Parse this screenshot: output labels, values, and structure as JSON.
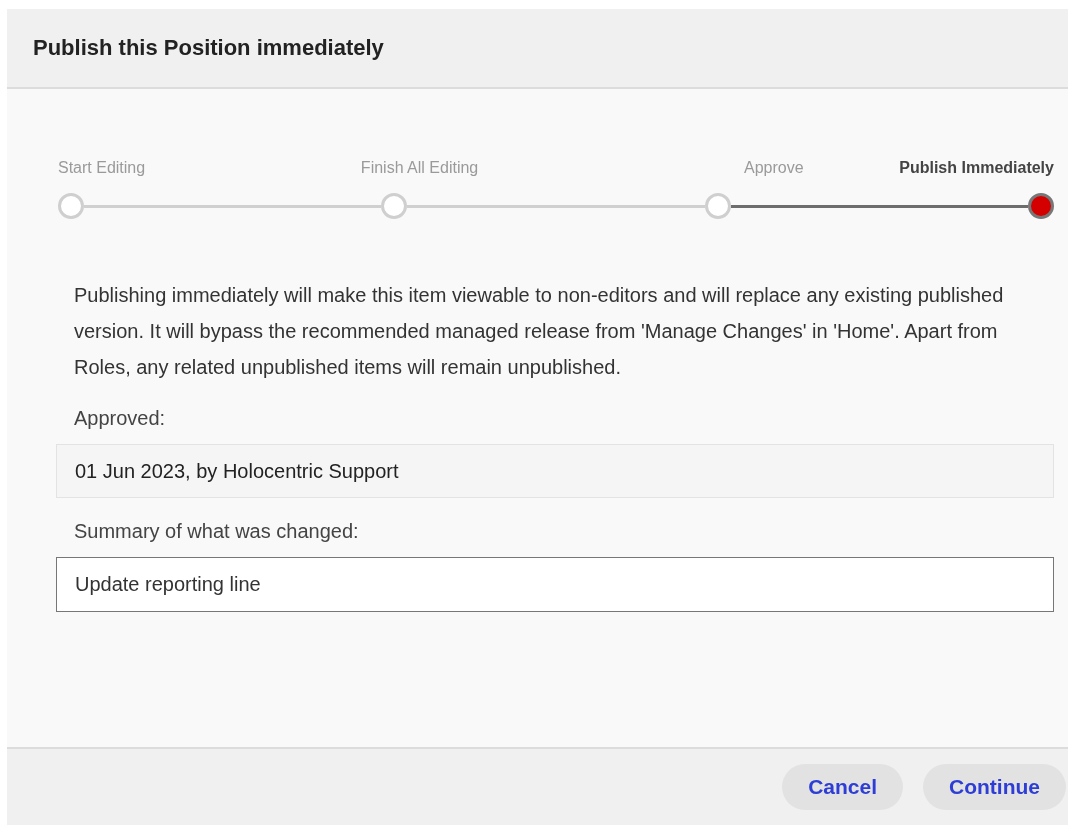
{
  "dialog": {
    "title": "Publish this Position immediately"
  },
  "steps": [
    {
      "label": "Start Editing",
      "selected": false
    },
    {
      "label": "Finish All Editing",
      "selected": false
    },
    {
      "label": "Approve",
      "selected": false
    },
    {
      "label": "Publish Immediately",
      "selected": true
    }
  ],
  "message": "Publishing immediately will make this item viewable to non-editors and will replace any existing published version. It will bypass the recommended managed release from 'Manage Changes' in 'Home'. Apart from Roles, any related unpublished items will remain unpublished.",
  "approved": {
    "label": "Approved:",
    "value": "01 Jun 2023, by Holocentric Support"
  },
  "summary": {
    "label": "Summary of what was changed:",
    "value": "Update reporting line"
  },
  "buttons": [
    "Cancel",
    "Continue"
  ]
}
